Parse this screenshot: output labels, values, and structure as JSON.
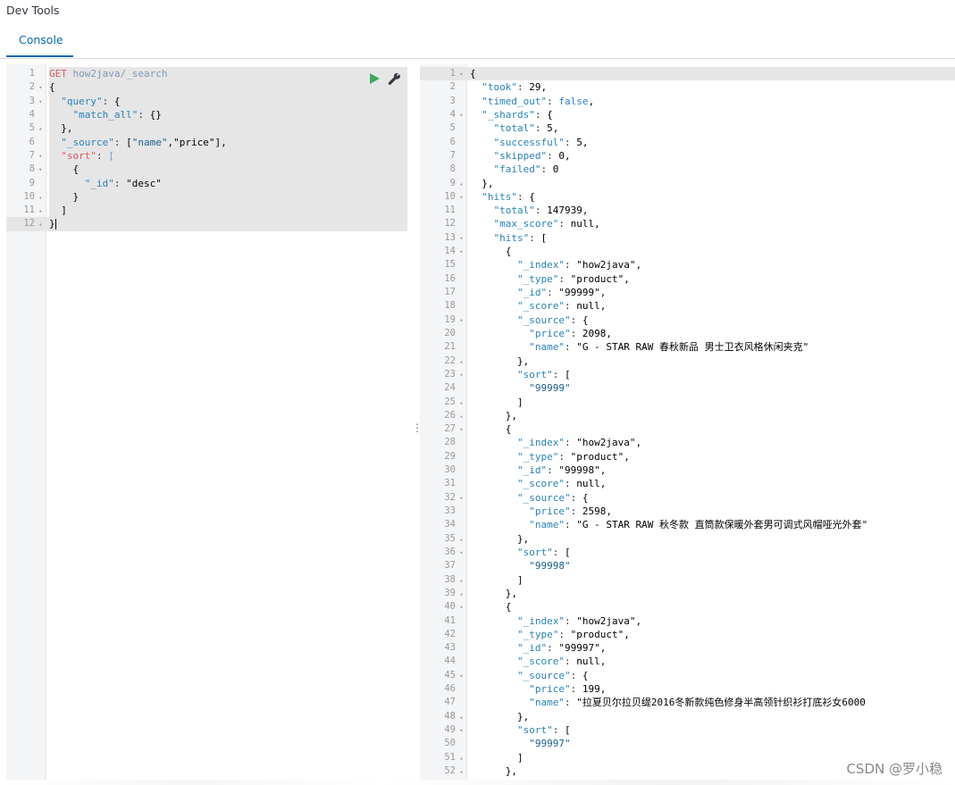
{
  "app": {
    "title": "Dev Tools"
  },
  "tabs": [
    {
      "label": "Console",
      "active": true
    }
  ],
  "request": {
    "method": "GET",
    "path": "how2java/_search",
    "body_lines": [
      "{",
      "  \"query\": {",
      "    \"match_all\": {}",
      "  },",
      "  \"_source\": [\"name\",\"price\"],",
      "  \"sort\": [",
      "    {",
      "      \"_id\": \"desc\"",
      "    }",
      "  ]",
      "}"
    ]
  },
  "response": {
    "lines": [
      "{",
      "  \"took\": 29,",
      "  \"timed_out\": false,",
      "  \"_shards\": {",
      "    \"total\": 5,",
      "    \"successful\": 5,",
      "    \"skipped\": 0,",
      "    \"failed\": 0",
      "  },",
      "  \"hits\": {",
      "    \"total\": 147939,",
      "    \"max_score\": null,",
      "    \"hits\": [",
      "      {",
      "        \"_index\": \"how2java\",",
      "        \"_type\": \"product\",",
      "        \"_id\": \"99999\",",
      "        \"_score\": null,",
      "        \"_source\": {",
      "          \"price\": 2098,",
      "          \"name\": \"G - STAR RAW 春秋新品 男士卫衣风格休闲夹克\"",
      "        },",
      "        \"sort\": [",
      "          \"99999\"",
      "        ]",
      "      },",
      "      {",
      "        \"_index\": \"how2java\",",
      "        \"_type\": \"product\",",
      "        \"_id\": \"99998\",",
      "        \"_score\": null,",
      "        \"_source\": {",
      "          \"price\": 2598,",
      "          \"name\": \"G - STAR RAW 秋冬款 直筒款保暖外套男可调式风帽哑光外套\"",
      "        },",
      "        \"sort\": [",
      "          \"99998\"",
      "        ]",
      "      },",
      "      {",
      "        \"_index\": \"how2java\",",
      "        \"_type\": \"product\",",
      "        \"_id\": \"99997\",",
      "        \"_score\": null,",
      "        \"_source\": {",
      "          \"price\": 199,",
      "          \"name\": \"拉夏贝尔拉贝缇2016冬新款纯色修身半高领针织衫打底衫女6000",
      "        },",
      "        \"sort\": [",
      "          \"99997\"",
      "        ]",
      "      },"
    ]
  },
  "watermark": "CSDN @罗小稳",
  "icons": {
    "run": "play-icon",
    "settings": "wrench-icon"
  },
  "colors": {
    "accent": "#006bb4",
    "run_button": "#3caa5a",
    "method": "#e0555f"
  }
}
